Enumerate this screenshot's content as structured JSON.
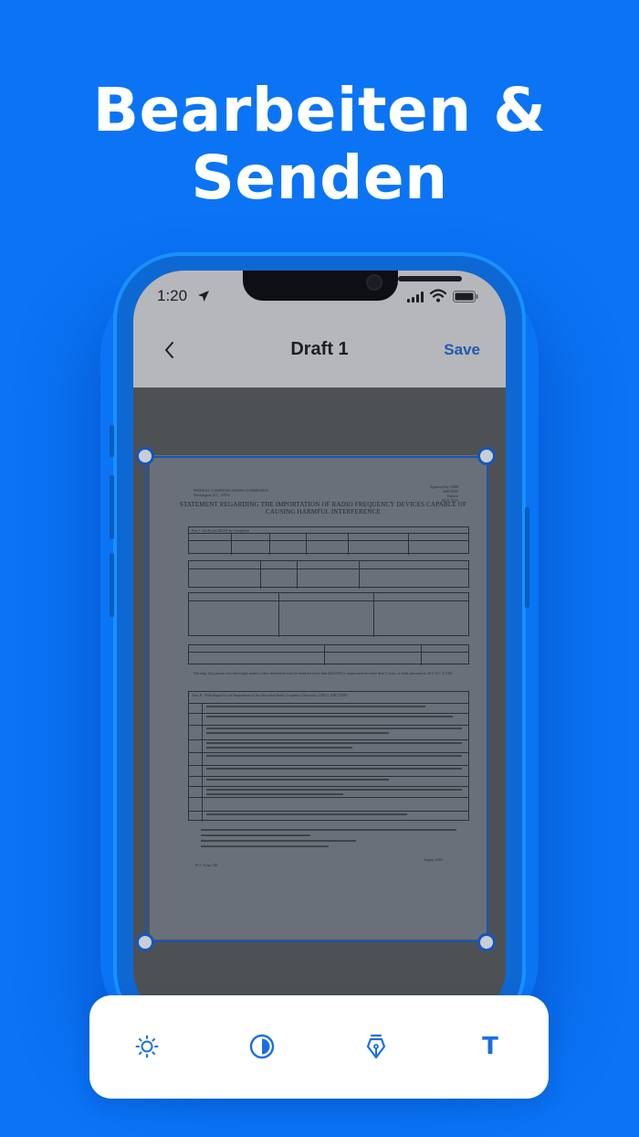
{
  "headline": {
    "line1": "Bearbeiten &",
    "line2": "Senden"
  },
  "statusbar": {
    "time": "1:20"
  },
  "navbar": {
    "title": "Draft 1",
    "save_label": "Save"
  },
  "document": {
    "header_left": [
      "FEDERAL COMMUNICATIONS COMMISSION",
      "Washington, D.C. 20554"
    ],
    "header_right": [
      "Approved by OMB",
      "3060-0059",
      "Expires",
      "06/31/2023"
    ],
    "title_line1": "STATEMENT REGARDING THE IMPORTATION OF RADIO FREQUENCY DEVICES CAPABLE OF",
    "title_line2": "CAUSING HARMFUL INTERFERENCE",
    "part1": "Part I : All Boxes MUST be Completed",
    "part2": "Part II : With Regard to the Importation of the Described Radio Frequency Device(s), I DECLARE THAT:",
    "warning": "Warning: Any person who knowingly makes a false declaration may be fined not more than $250,000 or imprisoned not more than 5 years, or both, pursuant to 18 U.S.C. § 1001.",
    "footer_left": "FCC Form 740",
    "footer_right": "August 2018"
  },
  "toolbar": {
    "items": [
      {
        "icon": "brightness-icon"
      },
      {
        "icon": "contrast-icon"
      },
      {
        "icon": "pen-nib-icon"
      },
      {
        "icon": "text-icon",
        "glyph": "T"
      }
    ]
  },
  "colors": {
    "background": "#0a74f5",
    "accent": "#1a6fe0",
    "save": "#1d5bb0"
  }
}
